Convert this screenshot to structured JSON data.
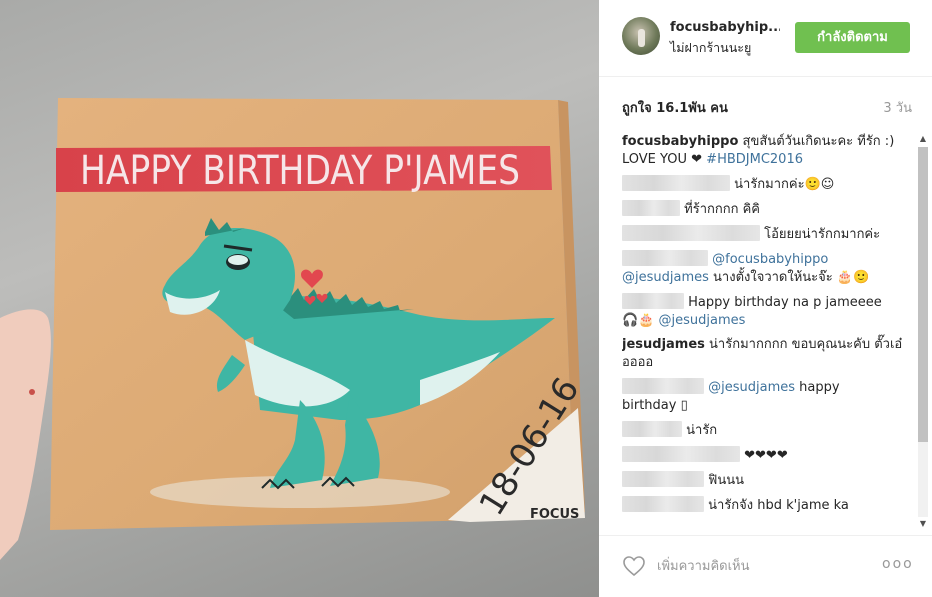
{
  "photo": {
    "banner_text": "HAPPY BIRTHDAY P'JAMES",
    "date_text": "18-06-16",
    "signature_text": "FOCUS"
  },
  "header": {
    "username": "focusbabyhip...",
    "location": "ไม่ฝากร้านนะยู",
    "follow_label": "กำลังติดตาม"
  },
  "stats": {
    "likes": "ถูกใจ 16.1พัน คน",
    "time_ago": "3 วัน"
  },
  "caption": {
    "username": "focusbabyhippo",
    "text": "สุขสันต์วันเกิดนะคะ ที่รัก :) LOVE YOU ❤",
    "hashtag": "#HBDJMC2016"
  },
  "comments": [
    {
      "text": "น่ารักมากค่ะ🙂☺"
    },
    {
      "text": "ที่ร้ากกกก คิคิ"
    },
    {
      "text": "โอ้ยยยน่ารักกมากค่ะ"
    },
    {
      "mention1": "@focusbabyhippo",
      "mention2": "@jesudjames",
      "text": "นางตั้งใจวาดให้นะจ๊ะ 🎂🙂"
    },
    {
      "text": "Happy birthday na p jameeee",
      "emoji": "🎧🎂",
      "mention": "@jesudjames"
    },
    {
      "username": "jesudjames",
      "text": "น่ารักมากกกก ขอบคุณนะคับ ตั๊วเอ๋ออออ"
    },
    {
      "mention": "@jesudjames",
      "text": "happy",
      "text2": "birthday ▯"
    },
    {
      "text": "น่ารัก"
    },
    {
      "text": "❤❤❤❤"
    },
    {
      "text": "ฟินนน"
    },
    {
      "text": "น่ารักจัง hbd k'jame ka"
    }
  ],
  "footer": {
    "placeholder": "เพิ่มความคิดเห็น",
    "more_label": "ooo"
  },
  "colors": {
    "follow_button": "#70c050",
    "link": "#3f729b",
    "canvas": "#e0ad78",
    "banner": "#dd4a4e",
    "dino": "#3fb6a4"
  }
}
